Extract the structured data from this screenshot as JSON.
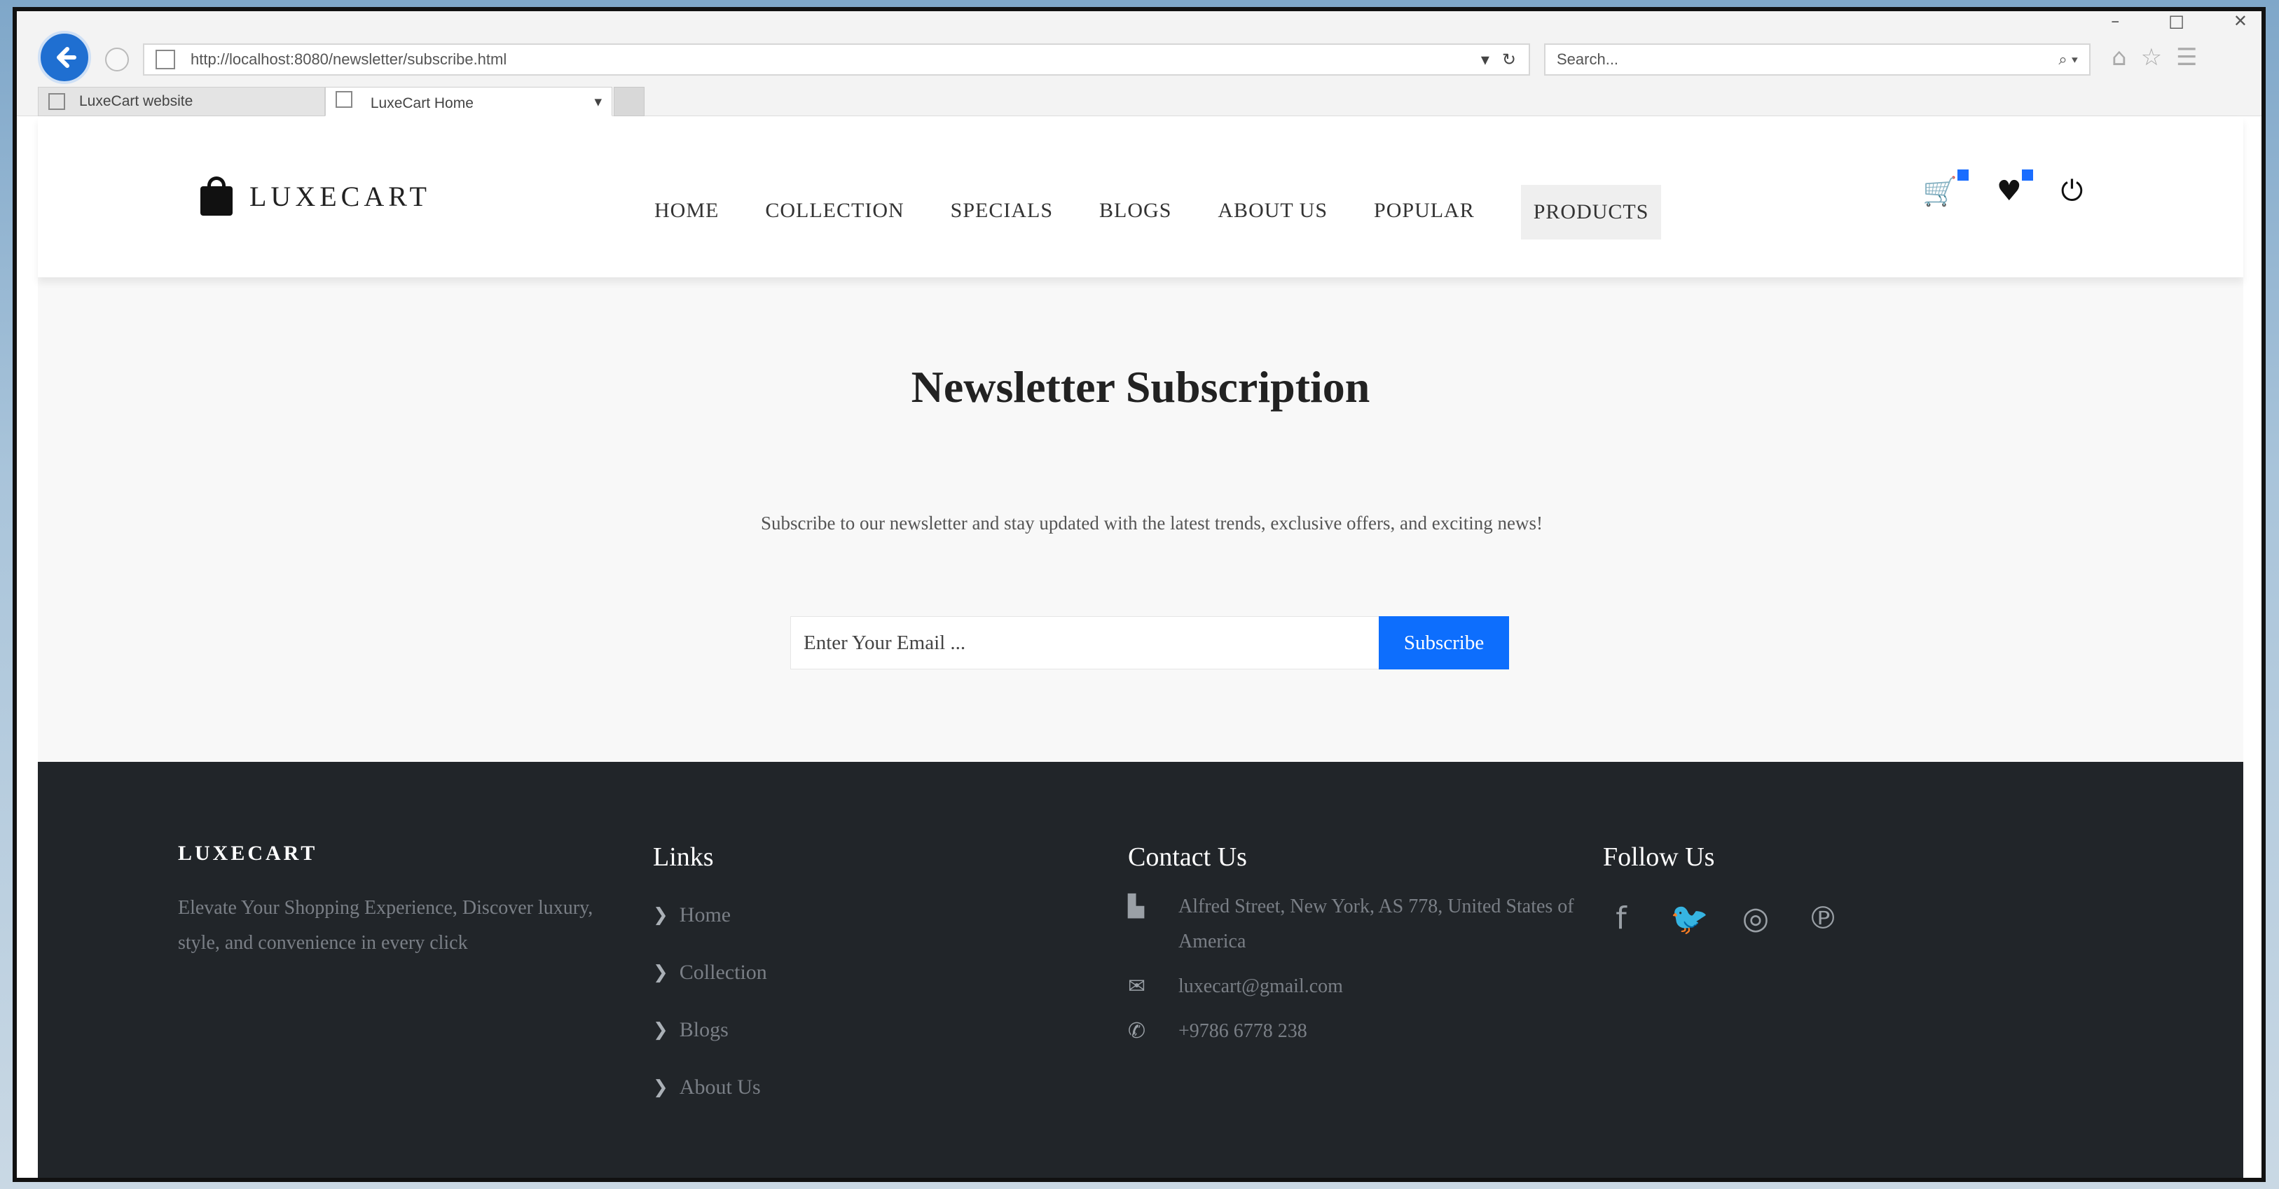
{
  "browser": {
    "address": "http://localhost:8080/newsletter/subscribe.html",
    "search_placeholder": "Search...",
    "tabs": [
      {
        "label": "LuxeCart website"
      },
      {
        "label": "LuxeCart Home"
      }
    ],
    "icons": {
      "back": "back-arrow-icon",
      "refresh": "refresh-icon",
      "search": "search-icon",
      "home": "home-icon",
      "favorites": "star-icon",
      "settings": "gear-icon"
    },
    "window_controls": [
      "–",
      "□",
      "✕"
    ],
    "addr_dropdown": "▾",
    "refresh_glyph": "↻",
    "search_glyph": "⌕ ▾",
    "tab_close": "▾"
  },
  "header": {
    "brand": "LUXECART",
    "nav": [
      {
        "label": "HOME"
      },
      {
        "label": "COLLECTION"
      },
      {
        "label": "SPECIALS"
      },
      {
        "label": "BLOGS"
      },
      {
        "label": "ABOUT US"
      },
      {
        "label": "POPULAR"
      },
      {
        "label": "PRODUCTS",
        "active": true
      }
    ],
    "icons": {
      "cart": "🛒",
      "wishlist": "♥",
      "logout": "⏻"
    },
    "accent": "#1a6dff"
  },
  "newsletter": {
    "title": "Newsletter Subscription",
    "description": "Subscribe to our newsletter and stay updated with the latest trends, exclusive offers, and exciting news!",
    "email_placeholder": "Enter Your Email ...",
    "button_label": "Subscribe",
    "button_color": "#0d6efd"
  },
  "footer": {
    "brand": "LUXECART",
    "tagline": "Elevate Your Shopping Experience, Discover luxury, style, and convenience in every click",
    "links_title": "Links",
    "links": [
      {
        "label": "Home"
      },
      {
        "label": "Collection"
      },
      {
        "label": "Blogs"
      },
      {
        "label": "About Us"
      }
    ],
    "contact_title": "Contact Us",
    "contact": {
      "address": "Alfred Street, New York, AS 778, United States of America",
      "email": "luxecart@gmail.com",
      "phone": "+9786 6778 238"
    },
    "follow_title": "Follow Us",
    "socials": [
      {
        "icon": "facebook-icon",
        "glyph": "f"
      },
      {
        "icon": "twitter-icon",
        "glyph": "🐦"
      },
      {
        "icon": "instagram-icon",
        "glyph": "◎"
      },
      {
        "icon": "pinterest-icon",
        "glyph": "℗"
      }
    ],
    "background": "#212529"
  }
}
